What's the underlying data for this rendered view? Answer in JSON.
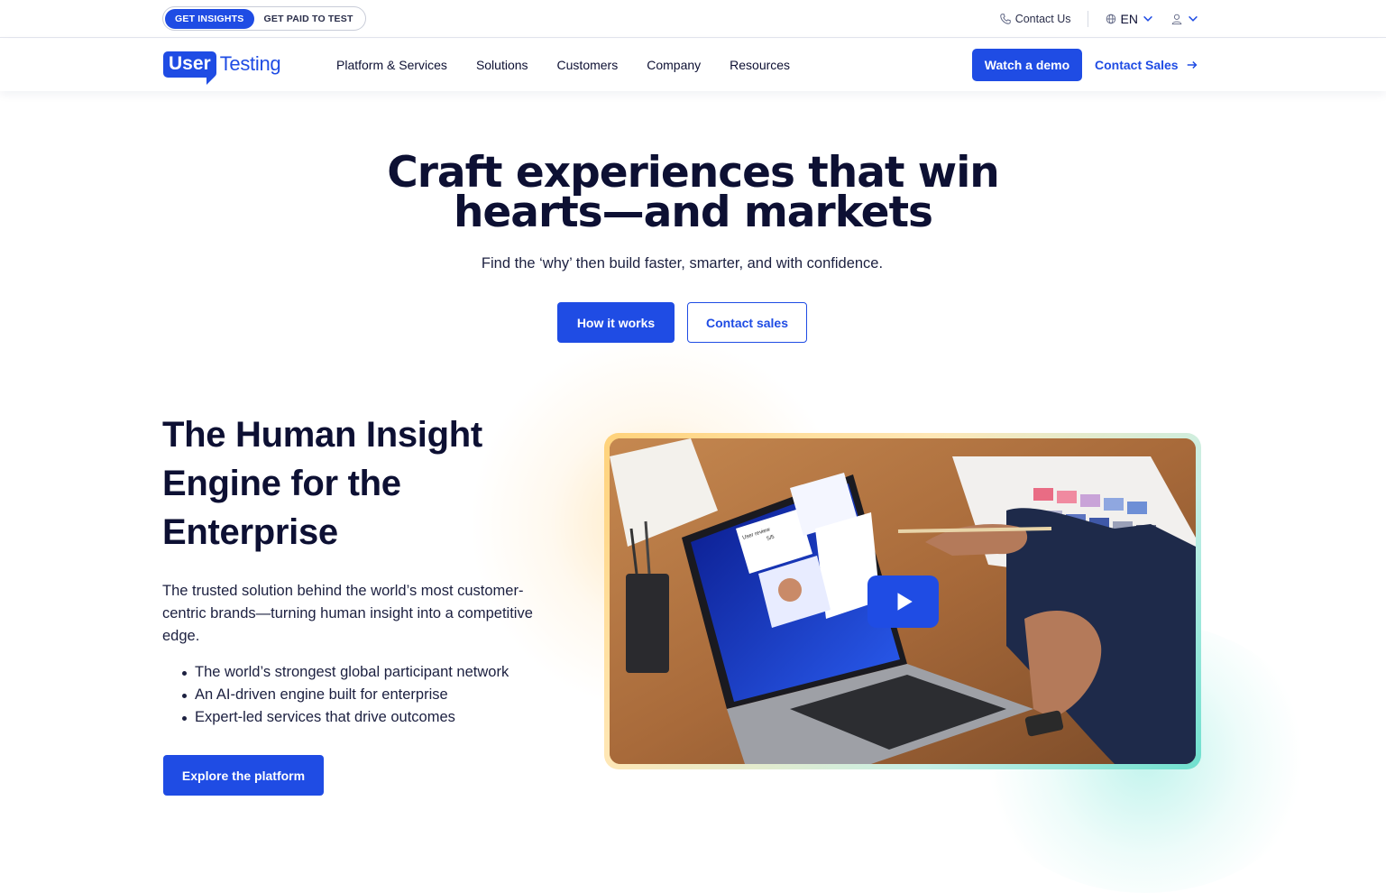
{
  "utility_bar": {
    "toggle": [
      "GET INSIGHTS",
      "GET PAID TO TEST"
    ],
    "contact_us": "Contact Us",
    "language": "EN"
  },
  "nav": {
    "logo_user": "User",
    "logo_testing": "Testing",
    "links": [
      "Platform & Services",
      "Solutions",
      "Customers",
      "Company",
      "Resources"
    ],
    "watch_demo": "Watch a demo",
    "contact_sales": "Contact Sales"
  },
  "hero": {
    "title_line1": "Craft experiences that win",
    "title_line2": "hearts—and markets",
    "subtitle": "Find the ‘why’ then build faster, smarter, and with confidence.",
    "btn_primary": "How it works",
    "btn_secondary": "Contact sales"
  },
  "engine": {
    "title": "The Human Insight Engine for the Enterprise",
    "description": "The trusted solution behind the world’s most customer-centric brands—turning human insight into a competitive edge.",
    "bullets": [
      "The world’s strongest global participant network",
      "An AI-driven engine built for enterprise",
      "Expert-led services that drive outcomes"
    ],
    "cta": "Explore the platform"
  },
  "video": {
    "card_label": "User review",
    "card_rating": "5/5"
  },
  "colors": {
    "brand": "#1f4ce4",
    "text": "#0d1033",
    "glow_warm": "#ffd27a",
    "glow_cool": "#6fe0cf"
  },
  "icons": [
    "phone-icon",
    "globe-icon",
    "chevron-down-icon",
    "user-icon",
    "arrow-right-icon",
    "play-icon"
  ]
}
